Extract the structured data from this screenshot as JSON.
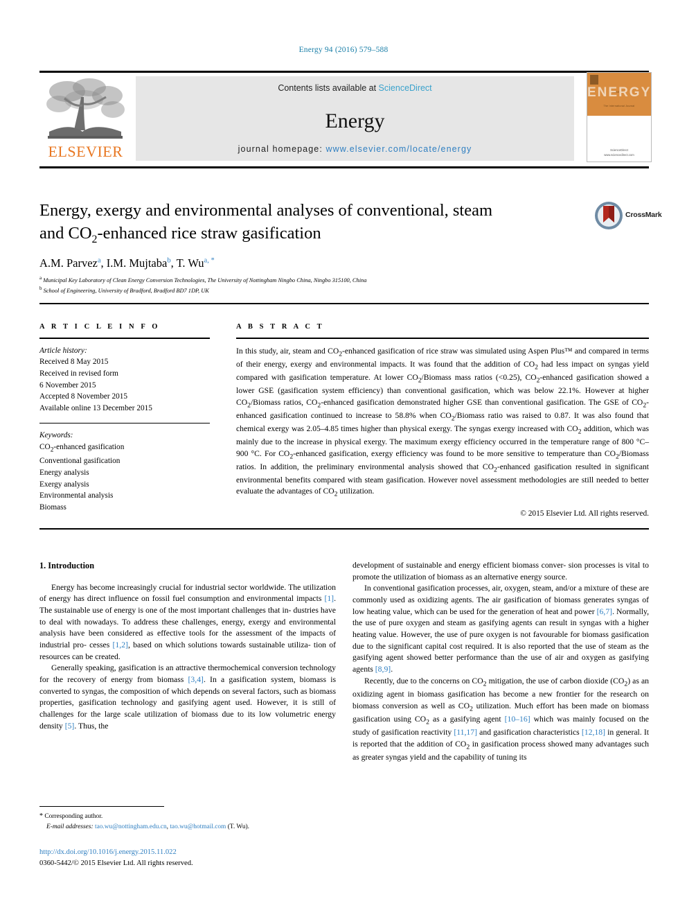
{
  "running_head": "Energy 94 (2016) 579–588",
  "masthead": {
    "contents_prefix": "Contents lists available at ",
    "sciencedirect": "ScienceDirect",
    "journal_name": "Energy",
    "homepage_prefix": "journal homepage: ",
    "homepage_url": "www.elsevier.com/locate/energy",
    "publisher": "ELSEVIER",
    "cover": {
      "title": "ENERGY",
      "tagline": "The International Journal",
      "footer": "Available online at\nScienceDirect\nwww.sciencedirect.com"
    },
    "colors": {
      "link": "#3aa2cc",
      "url": "#2f7fc1",
      "elsevier_orange": "#E87722",
      "band_gray": "#e6e6e6",
      "cover_orange": "#d98c3f"
    }
  },
  "article": {
    "title_line1": "Energy, exergy and environmental analyses of conventional, steam",
    "title_line2_pre": "and CO",
    "title_line2_sub": "2",
    "title_line2_post": "-enhanced rice straw gasification",
    "crossmark_label": "CrossMark",
    "authors": [
      {
        "name": "A.M. Parvez",
        "marks": "a"
      },
      {
        "name": "I.M. Mujtaba",
        "marks": "b"
      },
      {
        "name": "T. Wu",
        "marks": "a, *"
      }
    ],
    "affiliations": [
      {
        "mark": "a",
        "text": "Municipal Key Laboratory of Clean Energy Conversion Technologies, The University of Nottingham Ningbo China, Ningbo 315100, China"
      },
      {
        "mark": "b",
        "text": "School of Engineering, University of Bradford, Bradford BD7 1DP, UK"
      }
    ]
  },
  "article_info": {
    "heading": "A R T I C L E  I N F O",
    "history_label": "Article history:",
    "history": [
      "Received 8 May 2015",
      "Received in revised form",
      "6 November 2015",
      "Accepted 8 November 2015",
      "Available online 13 December 2015"
    ],
    "keywords_label": "Keywords:",
    "keywords": [
      "CO2-enhanced gasification",
      "Conventional gasification",
      "Energy analysis",
      "Exergy analysis",
      "Environmental analysis",
      "Biomass"
    ]
  },
  "abstract": {
    "heading": "A B S T R A C T",
    "text": "In this study, air, steam and CO2-enhanced gasification of rice straw was simulated using Aspen Plus™ and compared in terms of their energy, exergy and environmental impacts. It was found that the addition of CO2 had less impact on syngas yield compared with gasification temperature. At lower CO2/Biomass mass ratios (<0.25), CO2-enhanced gasification showed a lower GSE (gasification system efficiency) than conventional gasification, which was below 22.1%. However at higher CO2/Biomass ratios, CO2-enhanced gasification demonstrated higher GSE than conventional gasification. The GSE of CO2-enhanced gasification continued to increase to 58.8% when CO2/Biomass ratio was raised to 0.87. It was also found that chemical exergy was 2.05–4.85 times higher than physical exergy. The syngas exergy increased with CO2 addition, which was mainly due to the increase in physical exergy. The maximum exergy efficiency occurred in the temperature range of 800 °C–900 °C. For CO2-enhanced gasification, exergy efficiency was found to be more sensitive to temperature than CO2/Biomass ratios. In addition, the preliminary environmental analysis showed that CO2-enhanced gasification resulted in significant environmental benefits compared with steam gasification. However novel assessment methodologies are still needed to better evaluate the advantages of CO2 utilization.",
    "copyright": "© 2015 Elsevier Ltd. All rights reserved."
  },
  "body": {
    "section_heading": "1. Introduction",
    "left_paragraphs": [
      "Energy has become increasingly crucial for industrial sector worldwide. The utilization of energy has direct influence on fossil fuel consumption and environmental impacts [1]. The sustainable use of energy is one of the most important challenges that industries have to deal with nowadays. To address these challenges, energy, exergy and environmental analysis have been considered as effective tools for the assessment of the impacts of industrial processes [1,2], based on which solutions towards sustainable utilization of resources can be created.",
      "Generally speaking, gasification is an attractive thermochemical conversion technology for the recovery of energy from biomass [3,4]. In a gasification system, biomass is converted to syngas, the composition of which depends on several factors, such as biomass properties, gasification technology and gasifying agent used. However, it is still of challenges for the large scale utilization of biomass due to its low volumetric energy density [5]. Thus, the"
    ],
    "right_paragraphs": [
      "development of sustainable and energy efficient biomass conversion processes is vital to promote the utilization of biomass as an alternative energy source.",
      "In conventional gasification processes, air, oxygen, steam, and/or a mixture of these are commonly used as oxidizing agents. The air gasification of biomass generates syngas of low heating value, which can be used for the generation of heat and power [6,7]. Normally, the use of pure oxygen and steam as gasifying agents can result in syngas with a higher heating value. However, the use of pure oxygen is not favourable for biomass gasification due to the significant capital cost required. It is also reported that the use of steam as the gasifying agent showed better performance than the use of air and oxygen as gasifying agents [8,9].",
      "Recently, due to the concerns on CO2 mitigation, the use of carbon dioxide (CO2) as an oxidizing agent in biomass gasification has become a new frontier for the research on biomass conversion as well as CO2 utilization. Much effort has been made on biomass gasification using CO2 as a gasifying agent [10–16] which was mainly focused on the study of gasification reactivity [11,17] and gasification characteristics [12,18] in general. It is reported that the addition of CO2 in gasification process showed many advantages such as greater syngas yield and the capability of tuning its"
    ]
  },
  "footnotes": {
    "corresponding": "Corresponding author.",
    "email_label": "E-mail addresses:",
    "email1": "tao.wu@nottingham.edu.cn",
    "email2": "tao.wu@hotmail.com",
    "email_suffix": "(T. Wu).",
    "doi": "http://dx.doi.org/10.1016/j.energy.2015.11.022",
    "issn_line": "0360-5442/© 2015 Elsevier Ltd. All rights reserved."
  }
}
